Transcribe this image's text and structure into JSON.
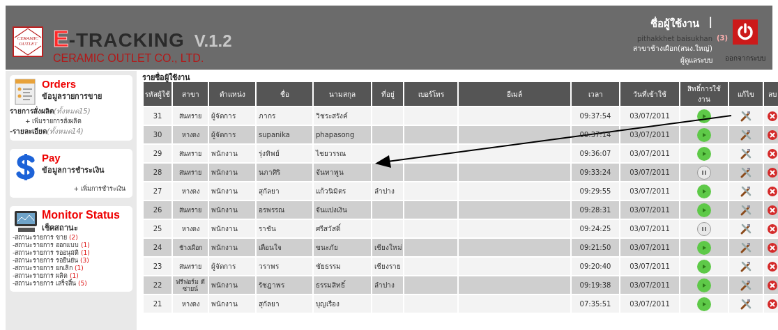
{
  "header": {
    "logo_text": [
      "CERAMIC",
      "OUTLET"
    ],
    "brand_letter": "E",
    "brand_rest": "-TRACKING",
    "version": "V.1.2",
    "company": "CERAMIC OUTLET CO., LTD.",
    "user_heading": "ชื่อผู้ใช้งาน",
    "separator": "|",
    "user_name": "pithakkhet  baisukhan",
    "user_count": "(3)",
    "branch": "สาขาช้างเผือก(สนง.ใหญ่)",
    "role": "ผู้ดูแลระบบ",
    "logout_label": "ออกจากระบบ"
  },
  "sidebar": {
    "cards": [
      {
        "kind": "orders",
        "title": "Orders",
        "subtitle": "ข้อมูลรายการขาย",
        "links": [
          {
            "label": "รายการสั่งผลิต",
            "note": "(ทั้งหมด15)"
          },
          {
            "label": "+ เพิ่มรายการสั่งผลิต"
          },
          {
            "label": "-รายละเอียด",
            "note": "(ทั้งหมด14)"
          }
        ]
      },
      {
        "kind": "pay",
        "title": "Pay",
        "subtitle": "ข้อมูลการชำระเงิน",
        "links": [
          {
            "label": "+ เพิ่มการชำระเงิน"
          }
        ]
      },
      {
        "kind": "monitor",
        "title": "Monitor Status",
        "subtitle": "เช็คสถานะ",
        "links": [
          {
            "label": "-สถานะรายการ ขาย",
            "count": "(2)"
          },
          {
            "label": "-สถานะรายการ ออกแบบ",
            "count": "(1)"
          },
          {
            "label": "-สถานะรายการ รออนุมัติ",
            "count": "(1)"
          },
          {
            "label": "-สถานะรายการ รอยืนยัน",
            "count": "(3)"
          },
          {
            "label": "-สถานะรายการ ยกเลิก",
            "count": "(1)"
          },
          {
            "label": "-สถานะรายการ ผลิต",
            "count": "(1)"
          },
          {
            "label": "-สถานะรายการ เสร็จสิ้น",
            "count": "(5)"
          }
        ]
      }
    ]
  },
  "table": {
    "title": "รายชื่อผู้ใช้งาน",
    "columns": [
      "รหัสผู้ใช้",
      "สาขา",
      "ตำแหน่ง",
      "ชื่อ",
      "นามสกุล",
      "ที่อยู่",
      "เบอร์โทร",
      "อีเมล์",
      "เวลา",
      "วันที่เข้าใช้",
      "สิทธิ์การใช้งาน",
      "แก้ไข",
      "ลบ"
    ],
    "rows": [
      {
        "id": "31",
        "branch": "สันทราย",
        "position": "ผู้จัดการ",
        "first_name": "ภากร",
        "last_name": "วิชระสรังค์",
        "time": "09:37:54",
        "date": "03/07/2011",
        "active": true
      },
      {
        "id": "30",
        "branch": "หางดง",
        "position": "ผู้จัดการ",
        "first_name": "supanika",
        "last_name": "phapasong",
        "time": "09:37:14",
        "date": "03/07/2011",
        "active": true
      },
      {
        "id": "29",
        "branch": "สันทราย",
        "position": "พนักงาน",
        "first_name": "รุ่งทิพย์",
        "last_name": "ไชยวรรณ",
        "time": "09:36:07",
        "date": "03/07/2011",
        "active": true
      },
      {
        "id": "28",
        "branch": "สันทราย",
        "position": "พนักงาน",
        "first_name": "นภาศิริ",
        "last_name": "จันทาพูน",
        "time": "09:33:24",
        "date": "03/07/2011",
        "active": false
      },
      {
        "id": "27",
        "branch": "หางดง",
        "position": "พนักงาน",
        "first_name": "สุกัลยา",
        "last_name": "แก้วนิมิตร",
        "address": "ลำปาง",
        "time": "09:29:55",
        "date": "03/07/2011",
        "active": true
      },
      {
        "id": "26",
        "branch": "สันทราย",
        "position": "พนักงาน",
        "first_name": "อรพรรณ",
        "last_name": "จันแปงเงิน",
        "time": "09:28:31",
        "date": "03/07/2011",
        "active": true
      },
      {
        "id": "25",
        "branch": "หางดง",
        "position": "พนักงาน",
        "first_name": "ราชัน",
        "last_name": "ศรีสวัสดิ์",
        "time": "09:24:25",
        "date": "03/07/2011",
        "active": false
      },
      {
        "id": "24",
        "branch": "ช้างเผือก",
        "position": "พนักงาน",
        "first_name": "เดือนใจ",
        "last_name": "ขนะภัย",
        "address": "เชียงใหม่",
        "time": "09:21:50",
        "date": "03/07/2011",
        "active": true
      },
      {
        "id": "23",
        "branch": "สันทราย",
        "position": "ผู้จัดการ",
        "first_name": "วราพร",
        "last_name": "ชัยธรรม",
        "address": "เชียงราย",
        "time": "09:20:40",
        "date": "03/07/2011",
        "active": true
      },
      {
        "id": "22",
        "branch": "ฟรีฟอร์ม ดีซายน์",
        "position": "พนักงาน",
        "first_name": "รัชฎาพร",
        "last_name": "ธรรมสิทธิ์",
        "address": "ลำปาง",
        "time": "09:19:38",
        "date": "03/07/2011",
        "active": true
      },
      {
        "id": "21",
        "branch": "หางดง",
        "position": "พนักงาน",
        "first_name": "สุกัลยา",
        "last_name": "บุญเรือง",
        "time": "07:35:51",
        "date": "03/07/2011",
        "active": true
      }
    ]
  }
}
